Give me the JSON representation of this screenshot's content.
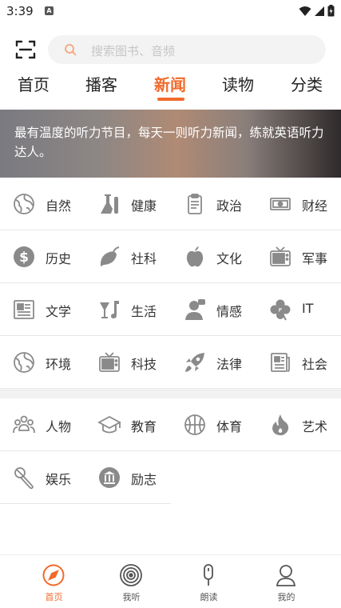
{
  "status_bar": {
    "time": "3:39",
    "notification_badge": "A"
  },
  "search": {
    "placeholder": "搜索图书、音频"
  },
  "tabs": [
    {
      "label": "首页",
      "active": false
    },
    {
      "label": "播客",
      "active": false
    },
    {
      "label": "新闻",
      "active": true
    },
    {
      "label": "读物",
      "active": false
    },
    {
      "label": "分类",
      "active": false
    }
  ],
  "banner": {
    "text": "最有温度的听力节目，每天一则听力新闻，练就英语听力达人。"
  },
  "categories": [
    {
      "label": "自然",
      "icon": "globe-icon"
    },
    {
      "label": "健康",
      "icon": "flask-icon"
    },
    {
      "label": "政治",
      "icon": "clipboard-icon"
    },
    {
      "label": "财经",
      "icon": "banknote-icon"
    },
    {
      "label": "历史",
      "icon": "dollar-icon"
    },
    {
      "label": "社科",
      "icon": "leaf-icon"
    },
    {
      "label": "文化",
      "icon": "apple-icon"
    },
    {
      "label": "军事",
      "icon": "tv-icon"
    },
    {
      "label": "文学",
      "icon": "newspaper-icon"
    },
    {
      "label": "生活",
      "icon": "drink-icon"
    },
    {
      "label": "情感",
      "icon": "person-icon"
    },
    {
      "label": "IT",
      "icon": "clover-icon"
    },
    {
      "label": "环境",
      "icon": "globe-icon"
    },
    {
      "label": "科技",
      "icon": "tv-icon"
    },
    {
      "label": "法律",
      "icon": "rocket-icon"
    },
    {
      "label": "社会",
      "icon": "newspaper-icon"
    },
    {
      "label": "人物",
      "icon": "people-icon"
    },
    {
      "label": "教育",
      "icon": "graduation-cap-icon"
    },
    {
      "label": "体育",
      "icon": "basketball-icon"
    },
    {
      "label": "艺术",
      "icon": "flame-icon"
    },
    {
      "label": "娱乐",
      "icon": "microphone-icon"
    },
    {
      "label": "励志",
      "icon": "trophy-icon"
    }
  ],
  "bottom_nav": [
    {
      "label": "首页",
      "icon": "compass-icon",
      "active": true
    },
    {
      "label": "我听",
      "icon": "vinyl-icon",
      "active": false
    },
    {
      "label": "朗读",
      "icon": "mic-icon",
      "active": false
    },
    {
      "label": "我的",
      "icon": "user-icon",
      "active": false
    }
  ],
  "colors": {
    "accent": "#f26a2b",
    "icon_gray": "#8a8a8a"
  }
}
